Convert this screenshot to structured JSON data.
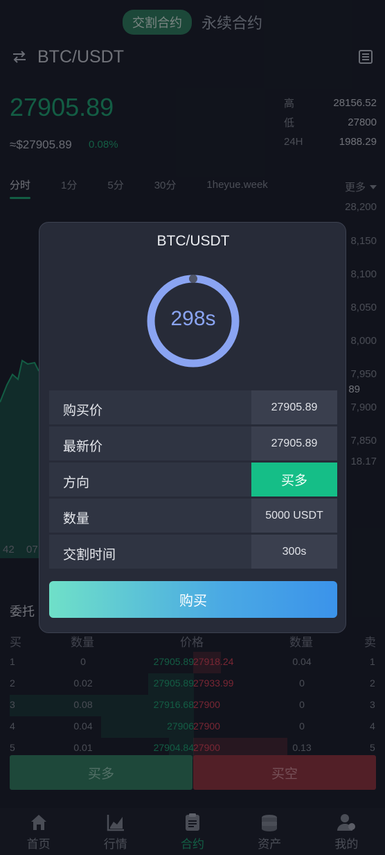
{
  "header": {
    "tab_delivery": "交割合约",
    "tab_perpetual": "永续合约",
    "pair": "BTC/USDT"
  },
  "ticker": {
    "price": "27905.89",
    "usd_price": "≈$27905.89",
    "change": "0.08%",
    "high_label": "高",
    "high_value": "28156.52",
    "low_label": "低",
    "low_value": "27800",
    "vol_label": "24H",
    "vol_value": "1988.29"
  },
  "intervals": [
    "分时",
    "1分",
    "5分",
    "30分",
    "1heyue.week"
  ],
  "intervals_more": "更多",
  "chart_axis": [
    "28,200",
    "8,150",
    "8,100",
    "8,050",
    "8,000",
    "7,950",
    "89",
    "7,900",
    "7,850",
    "18.17"
  ],
  "chart_times": [
    "42",
    "07"
  ],
  "book": {
    "title": "委托",
    "headers": {
      "buy": "买",
      "qty": "数量",
      "price": "价格",
      "qty2": "数量",
      "sell": "卖"
    },
    "rows": [
      {
        "idx": "1",
        "qty": "0",
        "bid": "27905.89",
        "ask": "27918.24",
        "aqty": "0.04",
        "ridx": "1"
      },
      {
        "idx": "2",
        "qty": "0.02",
        "bid": "27905.89",
        "ask": "27933.99",
        "aqty": "0",
        "ridx": "2"
      },
      {
        "idx": "3",
        "qty": "0.08",
        "bid": "27916.68",
        "ask": "27900",
        "aqty": "0",
        "ridx": "3"
      },
      {
        "idx": "4",
        "qty": "0.04",
        "bid": "27906",
        "ask": "27900",
        "aqty": "0",
        "ridx": "4"
      },
      {
        "idx": "5",
        "qty": "0.01",
        "bid": "27904.84",
        "ask": "27900",
        "aqty": "0.13",
        "ridx": "5"
      }
    ]
  },
  "actions": {
    "long": "买多",
    "short": "买空"
  },
  "nav": [
    {
      "label": "首页",
      "icon": "home-icon"
    },
    {
      "label": "行情",
      "icon": "chart-icon"
    },
    {
      "label": "合约",
      "icon": "contract-icon"
    },
    {
      "label": "资产",
      "icon": "coins-icon"
    },
    {
      "label": "我的",
      "icon": "user-icon"
    }
  ],
  "modal": {
    "title": "BTC/USDT",
    "countdown": "298s",
    "rows": [
      {
        "label": "购买价",
        "value": "27905.89"
      },
      {
        "label": "最新价",
        "value": "27905.89"
      },
      {
        "label": "方向",
        "value": "买多"
      },
      {
        "label": "数量",
        "value": "5000 USDT"
      },
      {
        "label": "交割时间",
        "value": "300s"
      }
    ],
    "buy_button": "购买"
  },
  "colors": {
    "accent_green": "#1aa06d",
    "accent_red": "#d23c4f",
    "countdown_blue": "#8aa4f2"
  }
}
